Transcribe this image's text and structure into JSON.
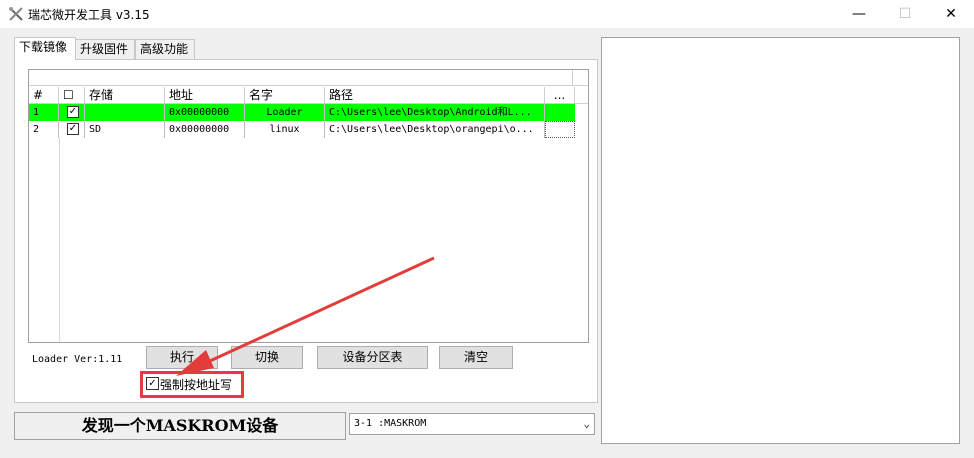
{
  "window": {
    "title": "瑞芯微开发工具 v3.15",
    "controls": {
      "minimize": "—",
      "maximize": "☐",
      "close": "✕"
    }
  },
  "tabs": [
    "下载镜像",
    "升级固件",
    "高级功能"
  ],
  "list": {
    "headers": [
      "#",
      "☐",
      "存储",
      "地址",
      "名字",
      "路径",
      "..."
    ],
    "rows": [
      {
        "num": "1",
        "checked": "✓",
        "storage": "",
        "address": "0x00000000",
        "name": "Loader",
        "path": "C:\\Users\\lee\\Desktop\\Android和L...",
        "selected": true
      },
      {
        "num": "2",
        "checked": "✓",
        "storage": "SD",
        "address": "0x00000000",
        "name": "linux",
        "path": "C:\\Users\\lee\\Desktop\\orangepi\\o...",
        "selected": false
      }
    ]
  },
  "loader_ver": "Loader Ver:1.11",
  "buttons": {
    "run": "执行",
    "switch": "切换",
    "partition": "设备分区表",
    "clear": "清空"
  },
  "force_write": {
    "checked": "✓",
    "label": "强制按地址写"
  },
  "status": "发现一个MASKROM设备",
  "device": {
    "selected": "3-1 :MASKROM"
  },
  "colors": {
    "selected_row": "#00ff00",
    "annotation": "#e43b3b"
  }
}
